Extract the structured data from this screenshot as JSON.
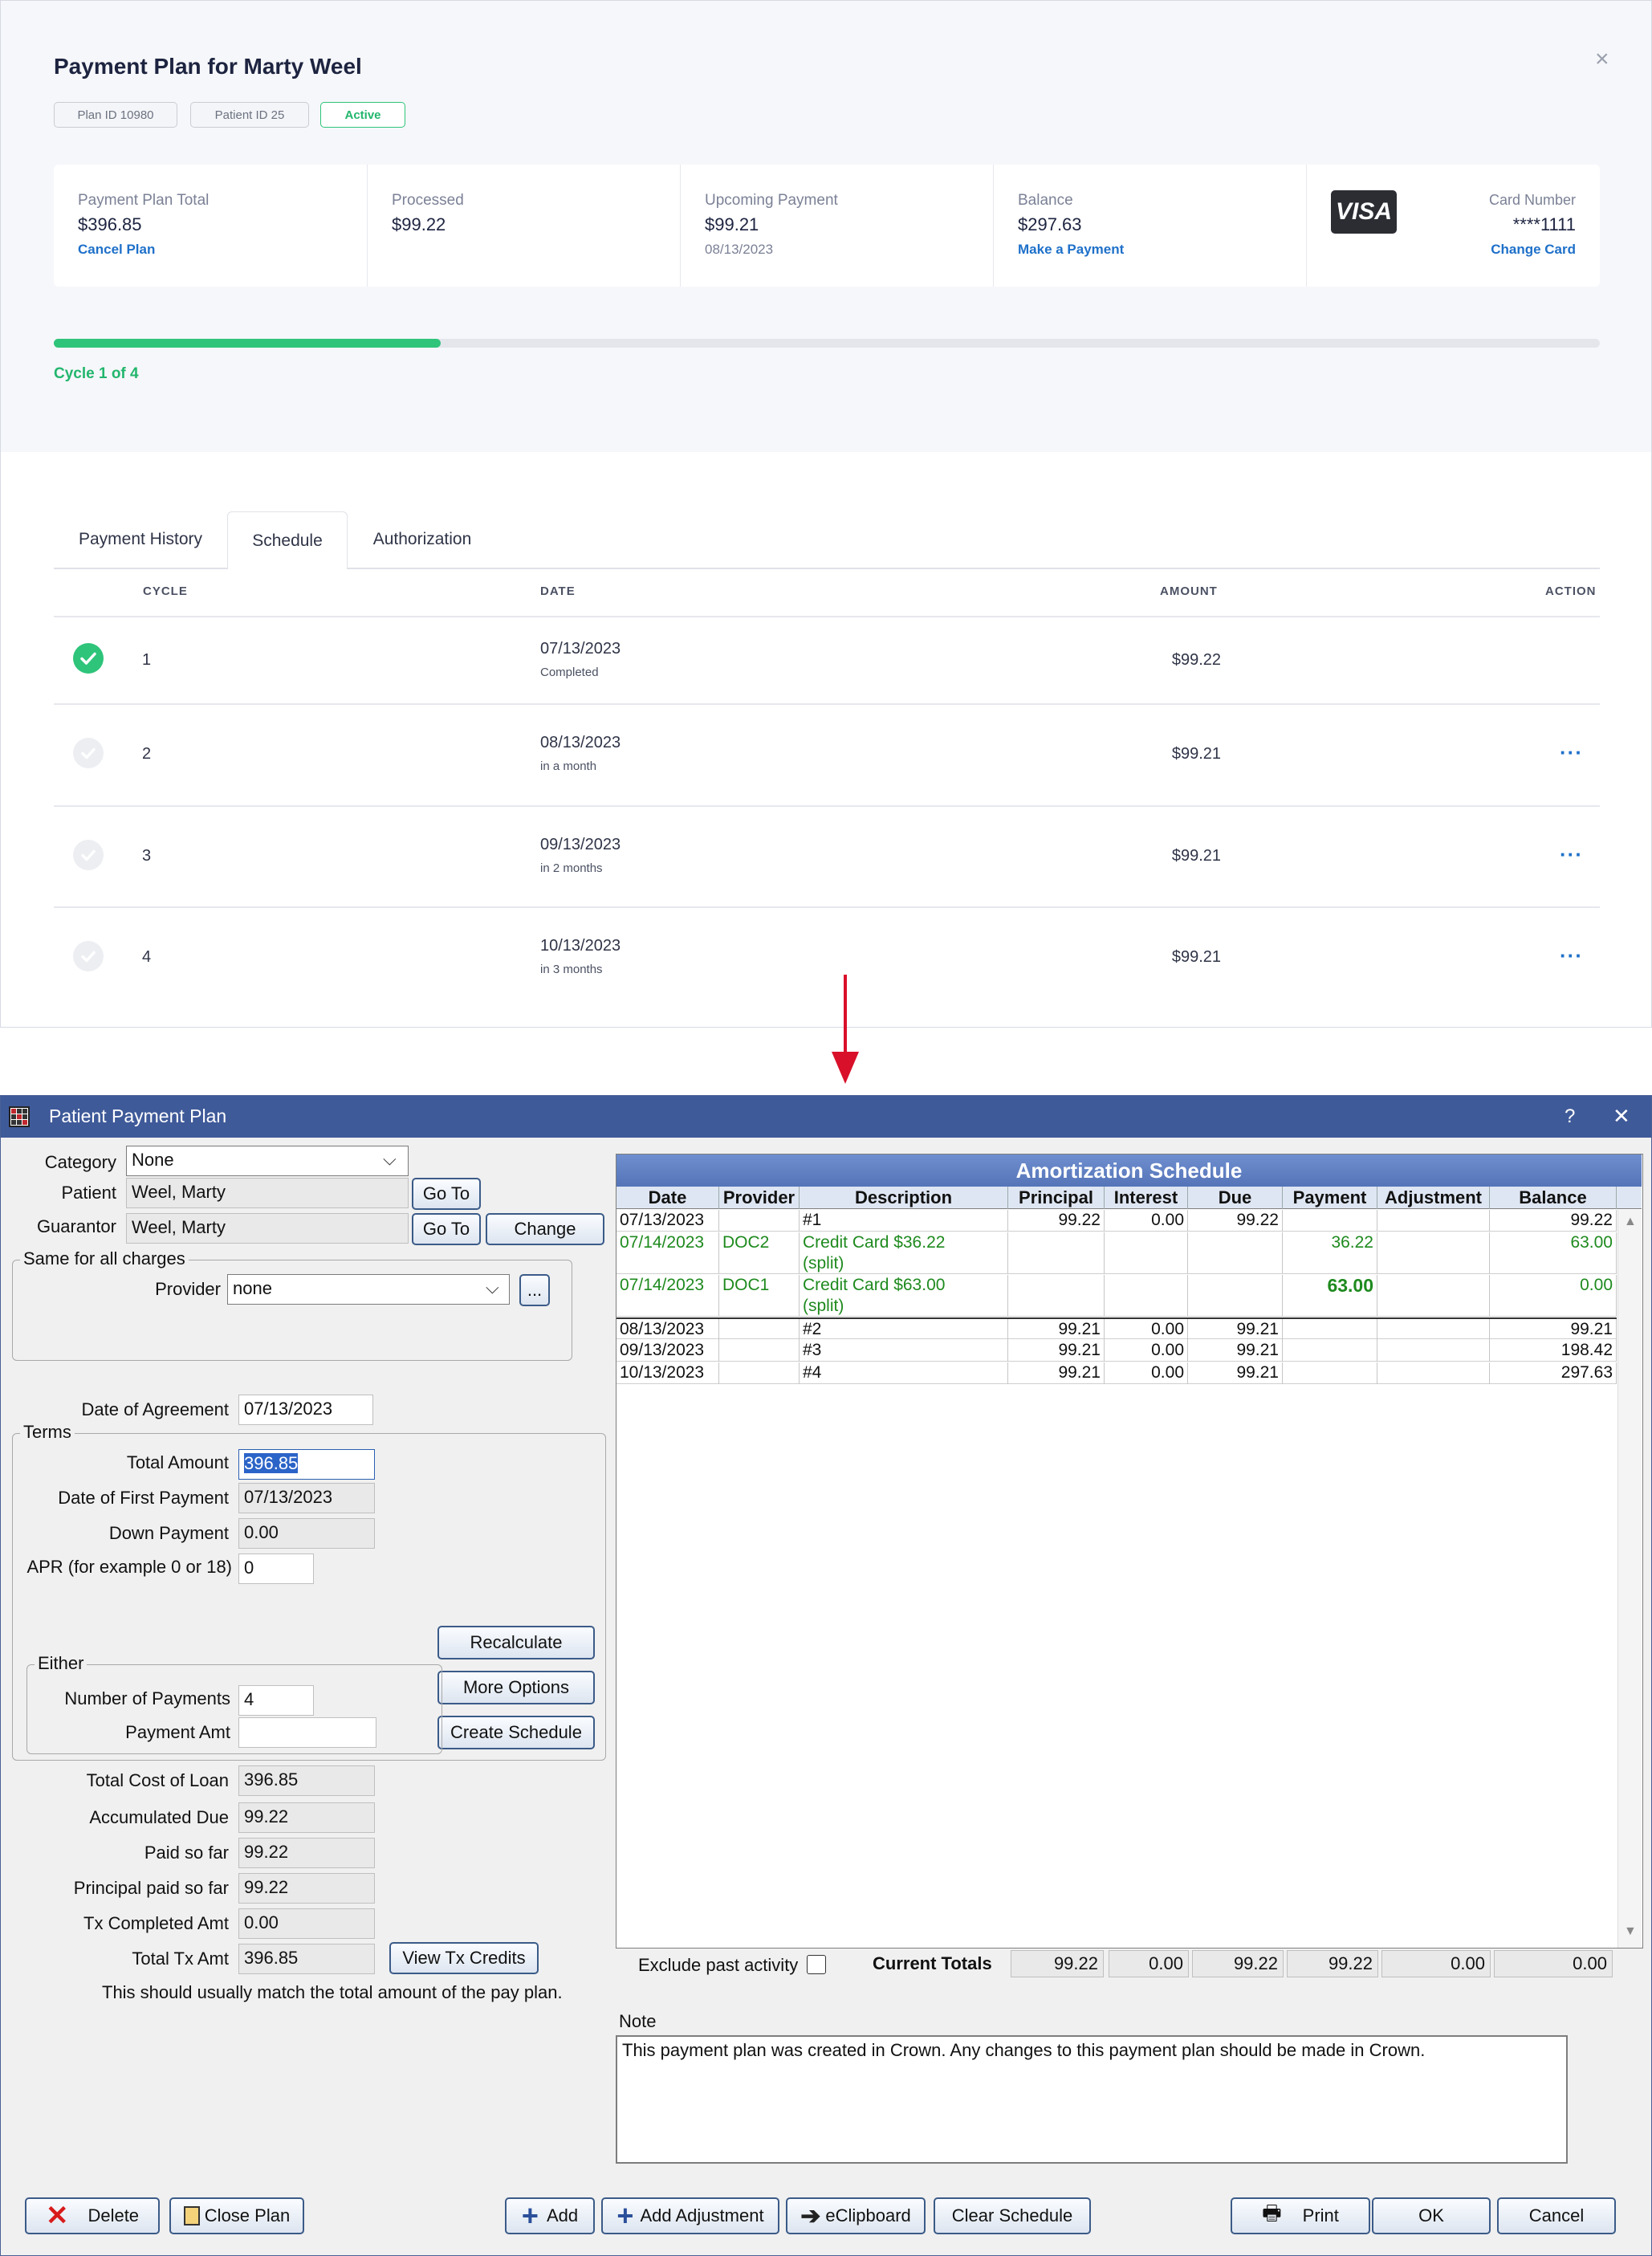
{
  "web": {
    "title": "Payment Plan for Marty Weel",
    "chips": {
      "plan_id": "Plan ID 10980",
      "patient_id": "Patient ID 25",
      "status": "Active"
    },
    "summary": {
      "total_label": "Payment Plan Total",
      "total_value": "$396.85",
      "cancel_link": "Cancel Plan",
      "processed_label": "Processed",
      "processed_value": "$99.22",
      "upcoming_label": "Upcoming Payment",
      "upcoming_value": "$99.21",
      "upcoming_date": "08/13/2023",
      "balance_label": "Balance",
      "balance_value": "$297.63",
      "make_payment_link": "Make a Payment",
      "card_brand": "VISA",
      "card_label": "Card Number",
      "card_value": "****1111",
      "change_card_link": "Change Card"
    },
    "progress": {
      "fraction": 0.25,
      "label": "Cycle 1 of 4"
    },
    "tabs": [
      "Payment History",
      "Schedule",
      "Authorization"
    ],
    "table": {
      "headers": {
        "cycle": "CYCLE",
        "date": "DATE",
        "amount": "AMOUNT",
        "action": "ACTION"
      },
      "rows": [
        {
          "cycle": "1",
          "date": "07/13/2023",
          "status": "Completed",
          "amount": "$99.22",
          "done": true
        },
        {
          "cycle": "2",
          "date": "08/13/2023",
          "status": "in a month",
          "amount": "$99.21",
          "done": false
        },
        {
          "cycle": "3",
          "date": "09/13/2023",
          "status": "in 2 months",
          "amount": "$99.21",
          "done": false
        },
        {
          "cycle": "4",
          "date": "10/13/2023",
          "status": "in 3 months",
          "amount": "$99.21",
          "done": false
        }
      ],
      "action_glyph": "···"
    }
  },
  "win": {
    "title": "Patient Payment Plan",
    "help": "?",
    "close": "✕",
    "labels": {
      "category": "Category",
      "patient": "Patient",
      "guarantor": "Guarantor",
      "same_for_all": "Same for all charges",
      "provider": "Provider",
      "date_of_agreement": "Date of Agreement",
      "terms": "Terms",
      "total_amount": "Total Amount",
      "date_first_payment": "Date of First Payment",
      "down_payment": "Down Payment",
      "apr": "APR (for example 0 or 18)",
      "either": "Either",
      "num_payments": "Number of Payments",
      "payment_amt": "Payment Amt",
      "total_cost": "Total Cost of Loan",
      "accumulated_due": "Accumulated Due",
      "paid_so_far": "Paid so far",
      "principal_paid": "Principal paid so far",
      "tx_completed": "Tx Completed Amt",
      "total_tx": "Total Tx Amt",
      "match_note": "This should usually match the total amount of the pay plan.",
      "exclude_past": "Exclude past activity",
      "current_totals": "Current Totals",
      "note": "Note"
    },
    "values": {
      "category": "None",
      "patient": "Weel, Marty",
      "guarantor": "Weel, Marty",
      "provider": "none",
      "date_of_agreement": "07/13/2023",
      "total_amount": "396.85",
      "date_first_payment": "07/13/2023",
      "down_payment": "0.00",
      "apr": "0",
      "num_payments": "4",
      "payment_amt": "",
      "total_cost": "396.85",
      "accumulated_due": "99.22",
      "paid_so_far": "99.22",
      "principal_paid": "99.22",
      "tx_completed": "0.00",
      "total_tx": "396.85",
      "note": "This payment plan was created in Crown. Any changes to this payment plan should be made in Crown."
    },
    "buttons": {
      "go_to": "Go To",
      "change": "Change",
      "ellipsis": "...",
      "recalculate": "Recalculate",
      "more_options": "More Options",
      "create_schedule": "Create Schedule",
      "view_tx_credits": "View Tx Credits",
      "delete": "Delete",
      "close_plan": "Close Plan",
      "add": "Add",
      "add_adjustment": "Add Adjustment",
      "eclipboard": "eClipboard",
      "clear_schedule": "Clear Schedule",
      "print": "Print",
      "ok": "OK",
      "cancel": "Cancel"
    },
    "schedule": {
      "title": "Amortization Schedule",
      "headers": [
        "Date",
        "Provider",
        "Description",
        "Principal",
        "Interest",
        "Due",
        "Payment",
        "Adjustment",
        "Balance"
      ],
      "rows": [
        {
          "date": "07/13/2023",
          "provider": "",
          "desc": "#1",
          "desc2": "",
          "principal": "99.22",
          "interest": "0.00",
          "due": "99.22",
          "payment": "",
          "adjustment": "",
          "balance": "99.22",
          "green": false,
          "bold": false
        },
        {
          "date": "07/14/2023",
          "provider": "DOC2",
          "desc": "Credit Card $36.22",
          "desc2": "(split)",
          "principal": "",
          "interest": "",
          "due": "",
          "payment": "36.22",
          "adjustment": "",
          "balance": "63.00",
          "green": true,
          "bold": false
        },
        {
          "date": "07/14/2023",
          "provider": "DOC1",
          "desc": "Credit Card $63.00",
          "desc2": "(split)",
          "principal": "",
          "interest": "",
          "due": "",
          "payment": "63.00",
          "adjustment": "",
          "balance": "0.00",
          "green": true,
          "bold": true
        },
        {
          "date": "08/13/2023",
          "provider": "",
          "desc": "#2",
          "desc2": "",
          "principal": "99.21",
          "interest": "0.00",
          "due": "99.21",
          "payment": "",
          "adjustment": "",
          "balance": "99.21",
          "green": false,
          "bold": false
        },
        {
          "date": "09/13/2023",
          "provider": "",
          "desc": "#3",
          "desc2": "",
          "principal": "99.21",
          "interest": "0.00",
          "due": "99.21",
          "payment": "",
          "adjustment": "",
          "balance": "198.42",
          "green": false,
          "bold": false
        },
        {
          "date": "10/13/2023",
          "provider": "",
          "desc": "#4",
          "desc2": "",
          "principal": "99.21",
          "interest": "0.00",
          "due": "99.21",
          "payment": "",
          "adjustment": "",
          "balance": "297.63",
          "green": false,
          "bold": false
        }
      ],
      "totals": {
        "principal": "99.22",
        "interest": "0.00",
        "due": "99.22",
        "payment": "99.22",
        "adjustment": "0.00",
        "balance": "0.00"
      }
    },
    "icons": {
      "scroll_up": "▲",
      "scroll_down": "▼",
      "dropdown": "⌵"
    }
  },
  "colors": {
    "accent_green": "#2ec47a",
    "link_blue": "#1e70c9",
    "titlebar": "#3f5a99",
    "arrow_red": "#d9102a",
    "schedule_green": "#1e8a1e"
  }
}
